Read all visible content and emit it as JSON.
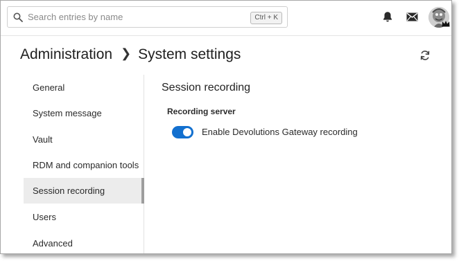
{
  "search": {
    "placeholder": "Search entries by name",
    "shortcut": "Ctrl + K"
  },
  "icons": {
    "search": "search-icon",
    "notifications": "bell-icon",
    "messages": "mail-icon",
    "refresh": "refresh-icon"
  },
  "breadcrumb": {
    "root": "Administration",
    "current": "System settings"
  },
  "sidebar": {
    "items": [
      {
        "label": "General"
      },
      {
        "label": "System message"
      },
      {
        "label": "Vault"
      },
      {
        "label": "RDM and companion tools"
      },
      {
        "label": "Session recording",
        "active": true
      },
      {
        "label": "Users"
      },
      {
        "label": "Advanced"
      }
    ]
  },
  "main": {
    "title": "Session recording",
    "section": "Recording server",
    "toggle": {
      "label": "Enable Devolutions Gateway recording",
      "on": true
    }
  },
  "colors": {
    "accent": "#1370cf",
    "active_bg": "#ececec"
  }
}
